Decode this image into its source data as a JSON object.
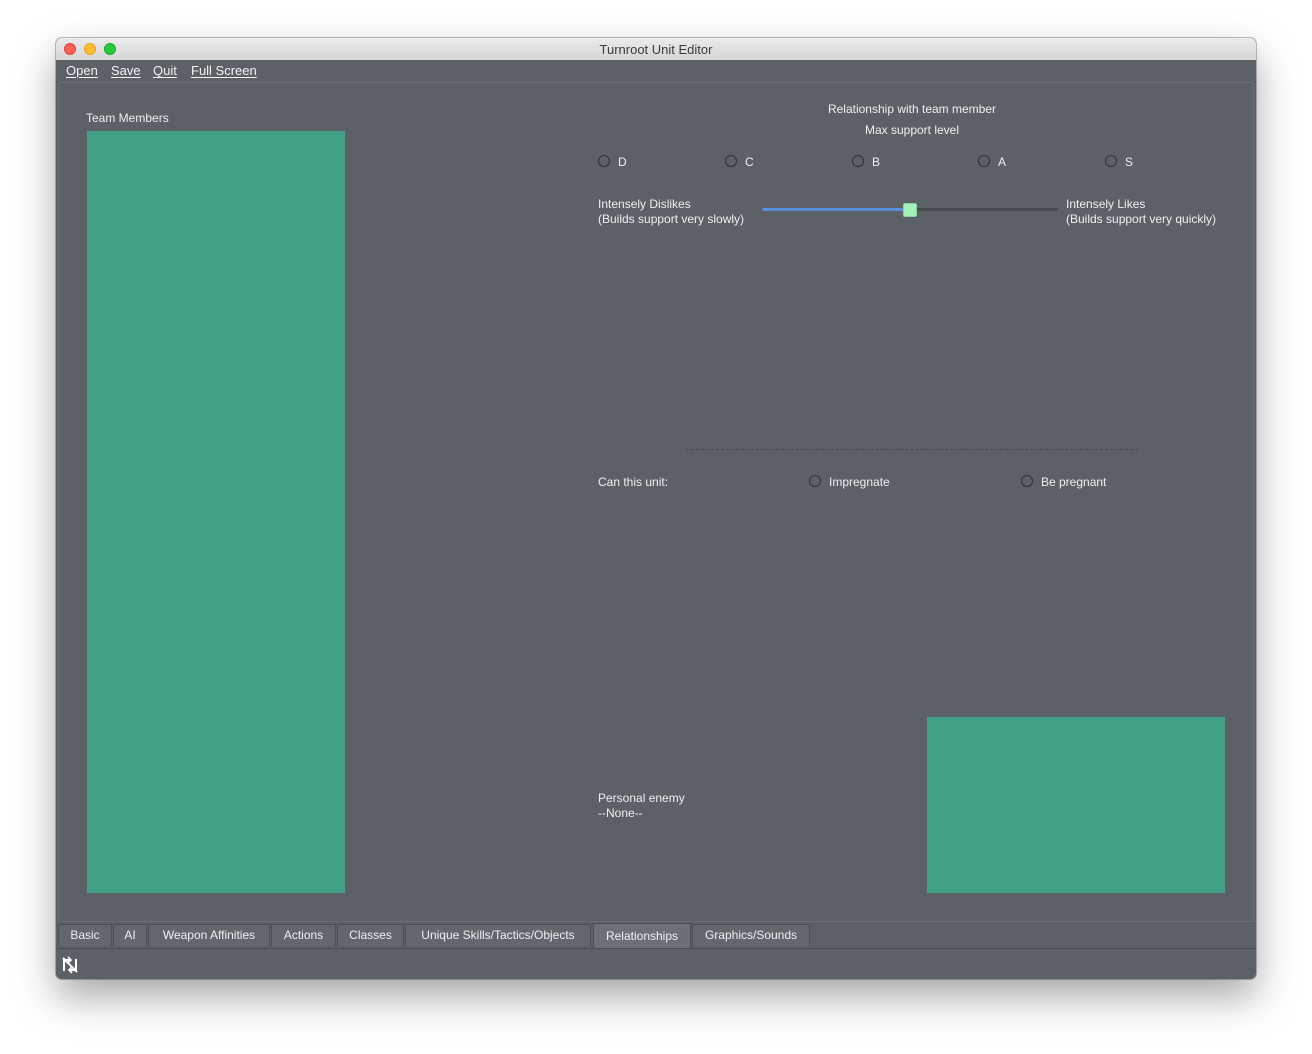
{
  "window": {
    "title": "Turnroot Unit Editor"
  },
  "menu": {
    "open": "Open",
    "save": "Save",
    "quit": "Quit",
    "full_screen": "Full Screen"
  },
  "team_members": {
    "label": "Team Members"
  },
  "relationship": {
    "title": "Relationship with team member",
    "max_support_label": "Max support level",
    "levels": [
      "D",
      "C",
      "B",
      "A",
      "S"
    ],
    "slider": {
      "left_label_line1": "Intensely Dislikes",
      "left_label_line2": "(Builds support very slowly)",
      "right_label_line1": "Intensely Likes",
      "right_label_line2": "(Builds support very quickly)",
      "value_fraction": 0.5
    }
  },
  "can_unit": {
    "label": "Can this unit:",
    "impregnate": "Impregnate",
    "be_pregnant": "Be pregnant"
  },
  "personal_enemy": {
    "label": "Personal enemy",
    "value": "--None--"
  },
  "tabs": [
    "Basic",
    "AI",
    "Weapon Affinities",
    "Actions",
    "Classes",
    "Unique Skills/Tactics/Objects",
    "Relationships",
    "Graphics/Sounds"
  ],
  "active_tab": "Relationships",
  "colors": {
    "background": "#5c6067",
    "panel_green": "#42a085",
    "slider_fill": "#5b8fd8",
    "slider_thumb": "#a5f0b8"
  },
  "icons": {
    "status_icon": "refresh-icon"
  }
}
